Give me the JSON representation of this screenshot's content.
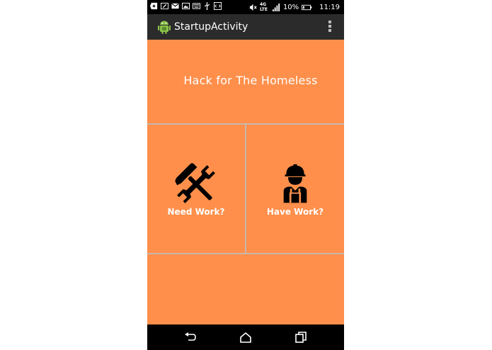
{
  "status_bar": {
    "battery_percent": "10%",
    "time": "11:19",
    "network": "4G LTE",
    "icons": [
      "add-icon",
      "edit-icon",
      "gmail-icon",
      "image-icon",
      "keyboard-icon",
      "usb-icon",
      "code-icon",
      "mute-icon",
      "signal-icon",
      "battery-icon"
    ]
  },
  "action_bar": {
    "title": "StartupActivity",
    "app_icon": "android-icon",
    "menu_icon": "overflow-menu-icon"
  },
  "main": {
    "heading": "Hack for The Homeless",
    "tiles": [
      {
        "label": "Need Work?",
        "icon": "tools-icon"
      },
      {
        "label": "Have Work?",
        "icon": "worker-icon"
      }
    ]
  },
  "nav_bar": {
    "buttons": [
      "back-icon",
      "home-icon",
      "recents-icon"
    ]
  },
  "colors": {
    "background": "#ff8f4b",
    "status_bar": "#000000",
    "action_bar": "#2b2b2b",
    "divider": "#c9b7ac"
  }
}
